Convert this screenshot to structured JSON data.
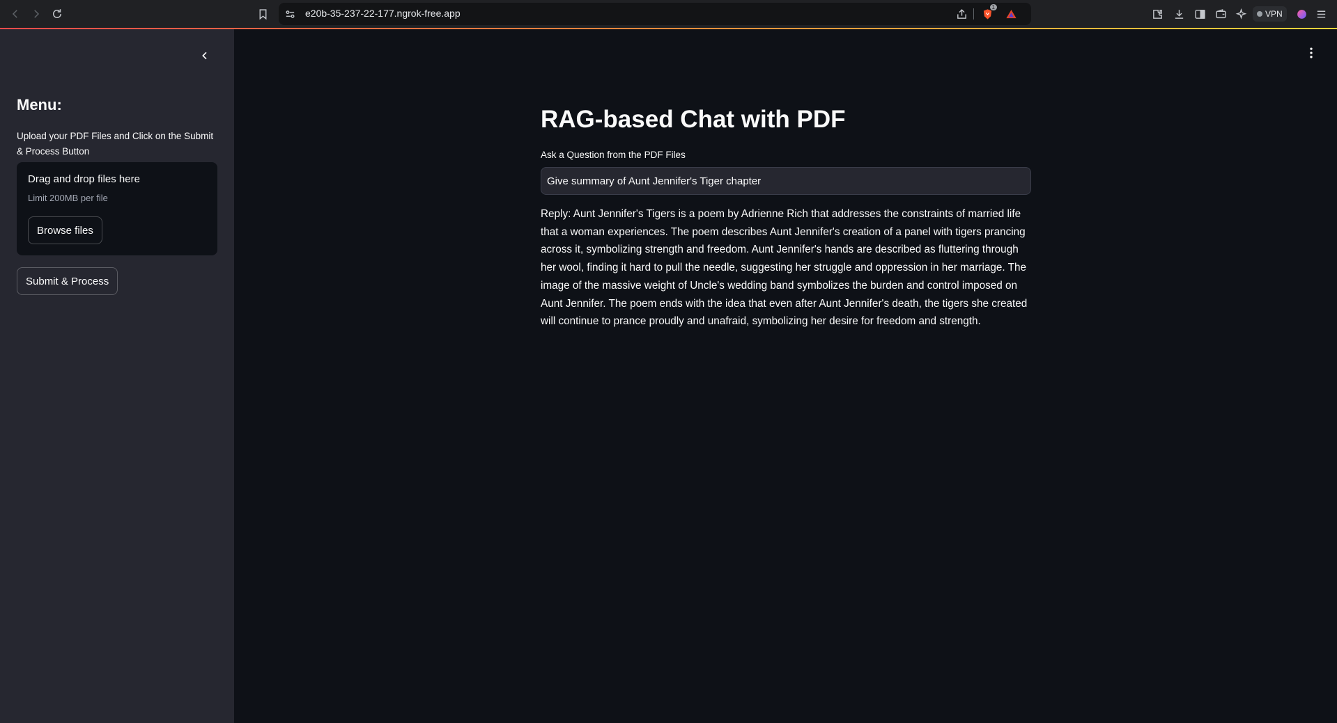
{
  "browser": {
    "url": "e20b-35-237-22-177.ngrok-free.app",
    "brave_badge_count": "1",
    "vpn_label": "VPN",
    "icons": [
      "back-icon",
      "forward-icon",
      "reload-icon",
      "bookmark-icon",
      "site-settings-icon",
      "share-icon",
      "brave-shields-icon",
      "brave-rewards-icon",
      "extensions-icon",
      "download-icon",
      "sidebar-icon",
      "wallet-icon",
      "leo-ai-icon",
      "profile-icon",
      "menu-icon"
    ]
  },
  "sidebar": {
    "title": "Menu:",
    "upload_label": "Upload your PDF Files and Click on the Submit & Process Button",
    "dropzone": {
      "title": "Drag and drop files here",
      "limit": "Limit 200MB per file",
      "browse_label": "Browse files"
    },
    "submit_label": "Submit & Process"
  },
  "main": {
    "title": "RAG-based Chat with PDF",
    "question_label": "Ask a Question from the PDF Files",
    "question_value": "Give summary of Aunt Jennifer's Tiger chapter",
    "reply": "Reply: Aunt Jennifer's Tigers is a poem by Adrienne Rich that addresses the constraints of married life that a woman experiences. The poem describes Aunt Jennifer's creation of a panel with tigers prancing across it, symbolizing strength and freedom. Aunt Jennifer's hands are described as fluttering through her wool, finding it hard to pull the needle, suggesting her struggle and oppression in her marriage. The image of the massive weight of Uncle's wedding band symbolizes the burden and control imposed on Aunt Jennifer. The poem ends with the idea that even after Aunt Jennifer's death, the tigers she created will continue to prance proudly and unafraid, symbolizing her desire for freedom and strength."
  },
  "colors": {
    "app_background": "#0e1117",
    "sidebar_background": "#262730",
    "text": "#fafafa",
    "accent": "#ff4b4b"
  }
}
